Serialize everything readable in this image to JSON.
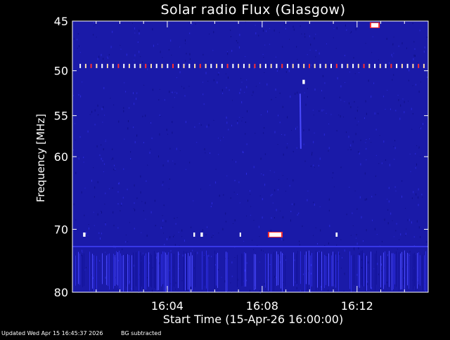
{
  "footer": {
    "updated": "Updated Wed Apr 15 16:45:37 2026",
    "bg_note": "BG subtracted"
  },
  "colors": {
    "background": "#000000",
    "plot_field": "#1a1aa8",
    "axis": "#ffffff",
    "text": "#ffffff",
    "burst_hot": "#ffffff",
    "burst_warm": "#ff3030"
  },
  "chart_data": {
    "type": "heatmap",
    "title": "Solar radio Flux (Glasgow)",
    "xlabel": "Start Time (15-Apr-26 16:00:00)",
    "ylabel": "Frequency [MHz]",
    "x_unit": "minutes after 16:00",
    "xlim": [
      0,
      15
    ],
    "ylim": [
      45,
      80
    ],
    "y_scale": "log",
    "y_reversed": true,
    "grid": false,
    "x_ticks": [
      {
        "value": 4,
        "label": "16:04"
      },
      {
        "value": 8,
        "label": "16:08"
      },
      {
        "value": 12,
        "label": "16:12"
      }
    ],
    "x_minor_ticks": [
      1,
      2,
      3,
      5,
      6,
      7,
      9,
      10,
      11,
      13,
      14
    ],
    "y_ticks": [
      {
        "value": 45,
        "label": "45"
      },
      {
        "value": 50,
        "label": "50"
      },
      {
        "value": 55,
        "label": "55"
      },
      {
        "value": 60,
        "label": "60"
      },
      {
        "value": 70,
        "label": "70"
      },
      {
        "value": 80,
        "label": "80"
      }
    ],
    "features": {
      "interference_band": {
        "freq_mhz": 49.5,
        "t_start": 0.3,
        "t_end": 14.9
      },
      "drifting_streak": {
        "t": 9.6,
        "freq_start": 52.5,
        "freq_end": 59.0
      },
      "spots": [
        {
          "t": 9.7,
          "freq_mhz": 51.2,
          "width_min": 0.1
        },
        {
          "t": 12.6,
          "freq_mhz": 45.4,
          "width_min": 0.3
        },
        {
          "t": 0.45,
          "freq_mhz": 70.8,
          "width_min": 0.1
        },
        {
          "t": 5.1,
          "freq_mhz": 70.8,
          "width_min": 0.07
        },
        {
          "t": 5.4,
          "freq_mhz": 70.8,
          "width_min": 0.1
        },
        {
          "t": 7.05,
          "freq_mhz": 70.8,
          "width_min": 0.05
        },
        {
          "t": 8.3,
          "freq_mhz": 70.8,
          "width_min": 0.5
        },
        {
          "t": 11.1,
          "freq_mhz": 70.8,
          "width_min": 0.08
        }
      ],
      "faint_line_mhz": 72.5,
      "striated_region": {
        "freq_start": 73.2,
        "freq_end": 80
      }
    }
  }
}
